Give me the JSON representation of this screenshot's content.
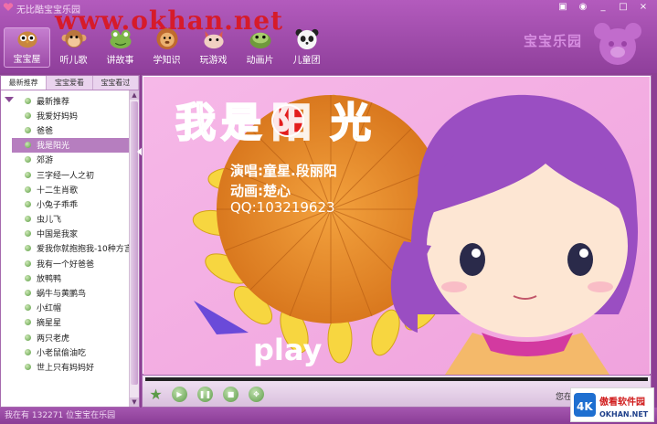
{
  "window": {
    "title": "无比酷宝宝乐园",
    "watermark": "www.okhan.net",
    "controls": [
      "▣",
      "◉",
      "_",
      "□",
      "×"
    ]
  },
  "nav": [
    {
      "label": "宝宝屋",
      "icon": "owl-icon",
      "active": true
    },
    {
      "label": "听儿歌",
      "icon": "monkey-icon"
    },
    {
      "label": "讲故事",
      "icon": "frog-icon"
    },
    {
      "label": "学知识",
      "icon": "lion-icon"
    },
    {
      "label": "玩游戏",
      "icon": "cat-icon"
    },
    {
      "label": "动画片",
      "icon": "turtle-icon"
    },
    {
      "label": "儿童团",
      "icon": "panda-icon"
    }
  ],
  "brand": {
    "text": "宝宝乐园"
  },
  "sidebar": {
    "tabs": [
      "最新推荐",
      "宝宝爱看",
      "宝宝看过"
    ],
    "items": [
      "最新推荐",
      "我爱好妈妈",
      "爸爸",
      "我是阳光",
      "郊游",
      "三字经一人之初",
      "十二生肖歌",
      "小兔子乖乖",
      "虫儿飞",
      "中国是我家",
      "爱我你就抱抱我-10种方言",
      "我有一个好爸爸",
      "放鸭鸭",
      "蜗牛与黄鹂鸟",
      "小红帽",
      "摘星星",
      "两只老虎",
      "小老鼠偷油吃",
      "世上只有妈妈好"
    ],
    "active_index": 3
  },
  "video": {
    "song_title_chars": [
      "我",
      "是",
      "阳",
      "光"
    ],
    "singer_line": "演唱:童星.段丽阳",
    "animation_line": "动画:楚心",
    "qq_line": "QQ:103219623",
    "play_label": "play"
  },
  "player": {
    "status_right": "您在",
    "controls": [
      "star-icon",
      "play-icon",
      "pause-icon",
      "stop-icon",
      "fullscreen-icon"
    ]
  },
  "statusbar": {
    "text": "我在有 132271 位宝宝在乐园"
  },
  "badge": {
    "brand": "傲看软件园",
    "domain": "OKHAN.NET"
  }
}
